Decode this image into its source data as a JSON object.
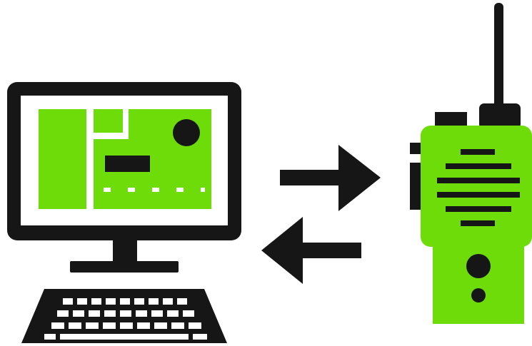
{
  "colors": {
    "ink": "#161616",
    "accent": "#6ddc08",
    "background": "#ffffff"
  },
  "icons": {
    "computer": "desktop-computer-icon",
    "keyboard": "keyboard-icon",
    "radio": "two-way-radio-icon",
    "send_arrow": "arrow-right-icon",
    "receive_arrow": "arrow-left-icon"
  }
}
